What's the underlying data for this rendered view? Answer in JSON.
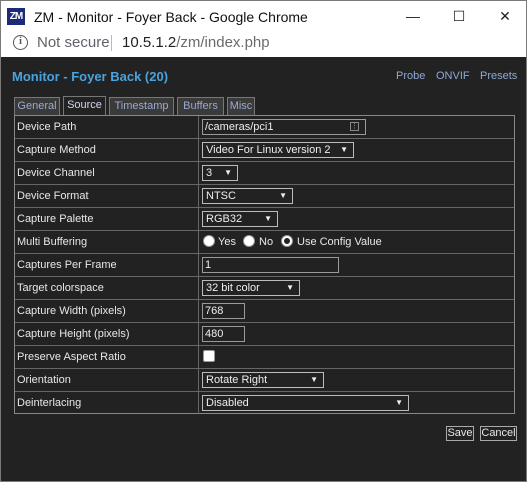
{
  "window": {
    "icon_text": "ZM",
    "title": "ZM - Monitor - Foyer Back - Google Chrome",
    "minimize": "—",
    "maximize": "☐",
    "close": "✕"
  },
  "address": {
    "security_text": "Not secure",
    "host": "10.5.1.2",
    "path": "/zm/index.php"
  },
  "page": {
    "title": "Monitor - Foyer Back (20)",
    "links": [
      "Probe",
      "ONVIF",
      "Presets"
    ]
  },
  "tabs": [
    "General",
    "Source",
    "Timestamp",
    "Buffers",
    "Misc"
  ],
  "active_tab": "Source",
  "form": {
    "device_path": {
      "label": "Device Path",
      "value": "/cameras/pci1"
    },
    "capture_method": {
      "label": "Capture Method",
      "value": "Video For Linux version 2"
    },
    "device_channel": {
      "label": "Device Channel",
      "value": "3"
    },
    "device_format": {
      "label": "Device Format",
      "value": "NTSC"
    },
    "capture_palette": {
      "label": "Capture Palette",
      "value": "RGB32"
    },
    "multi_buffering": {
      "label": "Multi Buffering",
      "options": [
        "Yes",
        "No",
        "Use Config Value"
      ],
      "selected": "Use Config Value"
    },
    "captures_per_frame": {
      "label": "Captures Per Frame",
      "value": "1"
    },
    "target_colorspace": {
      "label": "Target colorspace",
      "value": "32 bit color"
    },
    "capture_width": {
      "label": "Capture Width (pixels)",
      "value": "768"
    },
    "capture_height": {
      "label": "Capture Height (pixels)",
      "value": "480"
    },
    "preserve_aspect_ratio": {
      "label": "Preserve Aspect Ratio",
      "checked": false
    },
    "orientation": {
      "label": "Orientation",
      "value": "Rotate Right"
    },
    "deinterlacing": {
      "label": "Deinterlacing",
      "value": "Disabled"
    }
  },
  "buttons": {
    "save": "Save",
    "cancel": "Cancel"
  },
  "icons": {
    "app": "zoneminder-logo-icon",
    "security": "info-icon",
    "dropdown": "triangle-down-icon",
    "browse": "folder-browse-icon"
  },
  "colors": {
    "page_bg": "#222222",
    "title_blue": "#4aa3df",
    "link_blue": "#8fa8d6",
    "text": "#e8e8e8"
  }
}
